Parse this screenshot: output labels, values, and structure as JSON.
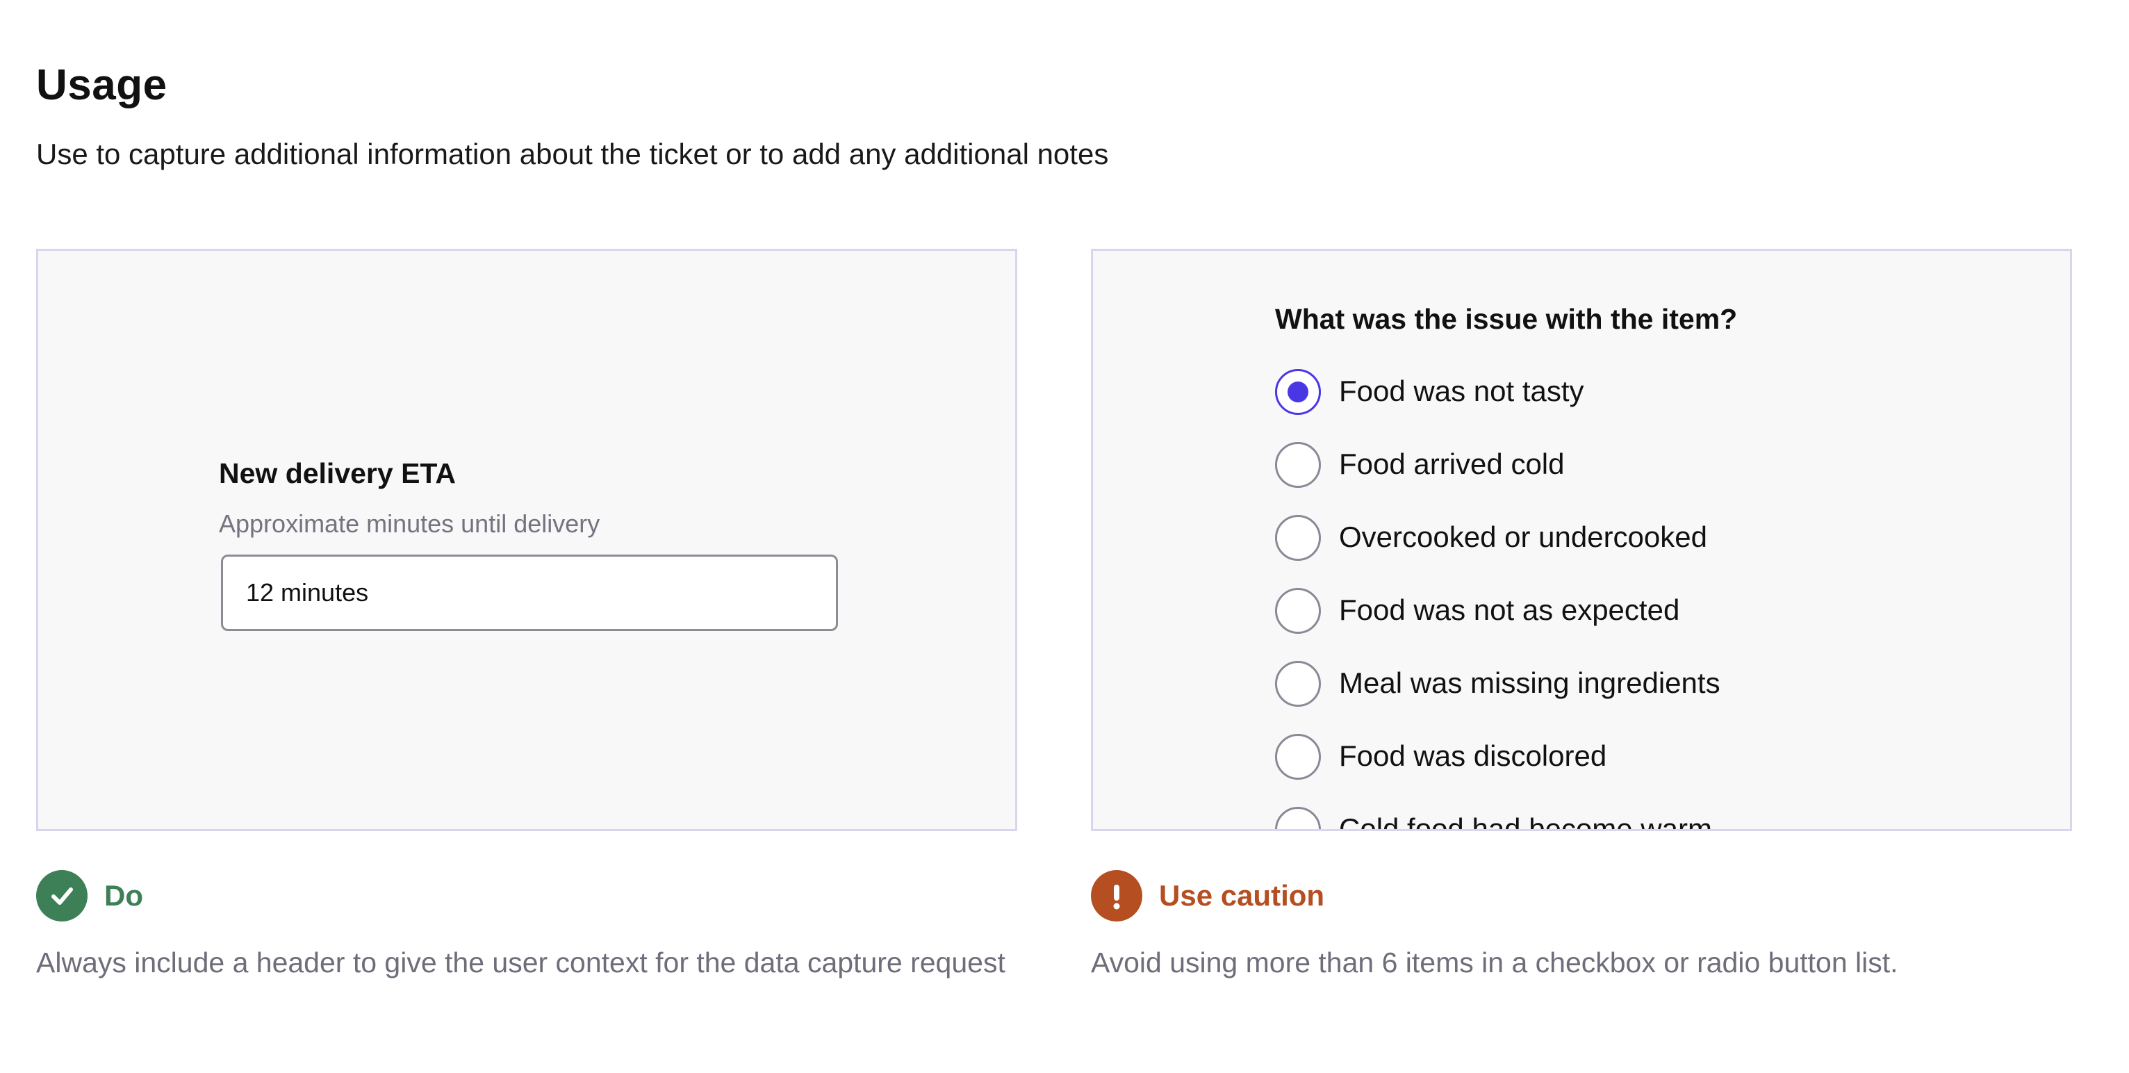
{
  "header": {
    "title": "Usage",
    "description": "Use to capture additional information about the ticket or to add any additional notes"
  },
  "examples": {
    "do": {
      "field_label": "New delivery ETA",
      "field_hint": "Approximate minutes until delivery",
      "input_value": "12 minutes",
      "status_label": "Do",
      "status_icon": "checkmark-icon",
      "status_color": "#3d7f56",
      "guidance": "Always include a header to give the user context for the data capture request"
    },
    "caution": {
      "question": "What was the issue with the item?",
      "options": [
        {
          "label": "Food was not tasty",
          "selected": true
        },
        {
          "label": "Food arrived cold",
          "selected": false
        },
        {
          "label": "Overcooked or undercooked",
          "selected": false
        },
        {
          "label": "Food was not as expected",
          "selected": false
        },
        {
          "label": "Meal was missing ingredients",
          "selected": false
        },
        {
          "label": "Food was discolored",
          "selected": false
        },
        {
          "label": "Cold food had become warm",
          "selected": false
        }
      ],
      "status_label": "Use caution",
      "status_icon": "exclamation-icon",
      "status_color": "#b54e21",
      "guidance": "Avoid using more than 6 items in a checkbox or radio button list."
    }
  },
  "colors": {
    "accent": "#4a37e4",
    "panel_background": "#f8f8f9",
    "panel_border": "#d7d6ef"
  }
}
